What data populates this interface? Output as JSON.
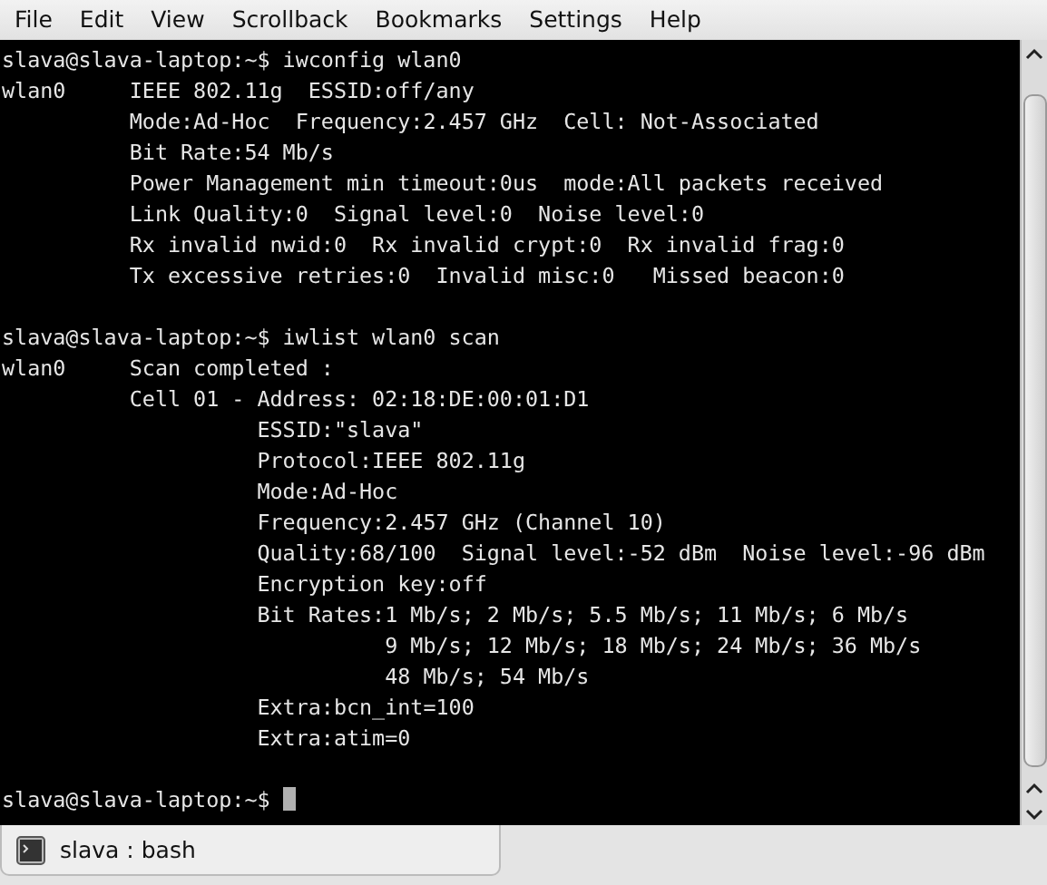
{
  "menu": [
    "File",
    "Edit",
    "View",
    "Scrollback",
    "Bookmarks",
    "Settings",
    "Help"
  ],
  "terminal": {
    "lines": [
      {
        "kind": "prompt",
        "prompt": "slava@slava-laptop:~$",
        "command": "iwconfig wlan0"
      },
      {
        "kind": "text",
        "text": "wlan0     IEEE 802.11g  ESSID:off/any"
      },
      {
        "kind": "text",
        "text": "          Mode:Ad-Hoc  Frequency:2.457 GHz  Cell: Not-Associated"
      },
      {
        "kind": "text",
        "text": "          Bit Rate:54 Mb/s"
      },
      {
        "kind": "text",
        "text": "          Power Management min timeout:0us  mode:All packets received"
      },
      {
        "kind": "text",
        "text": "          Link Quality:0  Signal level:0  Noise level:0"
      },
      {
        "kind": "text",
        "text": "          Rx invalid nwid:0  Rx invalid crypt:0  Rx invalid frag:0"
      },
      {
        "kind": "text",
        "text": "          Tx excessive retries:0  Invalid misc:0   Missed beacon:0"
      },
      {
        "kind": "blank"
      },
      {
        "kind": "prompt",
        "prompt": "slava@slava-laptop:~$",
        "command": "iwlist wlan0 scan"
      },
      {
        "kind": "text",
        "text": "wlan0     Scan completed :"
      },
      {
        "kind": "text",
        "text": "          Cell 01 - Address: 02:18:DE:00:01:D1"
      },
      {
        "kind": "text",
        "text": "                    ESSID:\"slava\""
      },
      {
        "kind": "text",
        "text": "                    Protocol:IEEE 802.11g"
      },
      {
        "kind": "text",
        "text": "                    Mode:Ad-Hoc"
      },
      {
        "kind": "text",
        "text": "                    Frequency:2.457 GHz (Channel 10)"
      },
      {
        "kind": "text",
        "text": "                    Quality:68/100  Signal level:-52 dBm  Noise level:-96 dBm"
      },
      {
        "kind": "text",
        "text": "                    Encryption key:off"
      },
      {
        "kind": "text",
        "text": "                    Bit Rates:1 Mb/s; 2 Mb/s; 5.5 Mb/s; 11 Mb/s; 6 Mb/s"
      },
      {
        "kind": "text",
        "text": "                              9 Mb/s; 12 Mb/s; 18 Mb/s; 24 Mb/s; 36 Mb/s"
      },
      {
        "kind": "text",
        "text": "                              48 Mb/s; 54 Mb/s"
      },
      {
        "kind": "text",
        "text": "                    Extra:bcn_int=100"
      },
      {
        "kind": "text",
        "text": "                    Extra:atim=0"
      },
      {
        "kind": "blank"
      },
      {
        "kind": "prompt",
        "prompt": "slava@slava-laptop:~$",
        "cursor": true
      }
    ]
  },
  "tabs": [
    {
      "label": "slava : bash",
      "selected": true
    }
  ]
}
